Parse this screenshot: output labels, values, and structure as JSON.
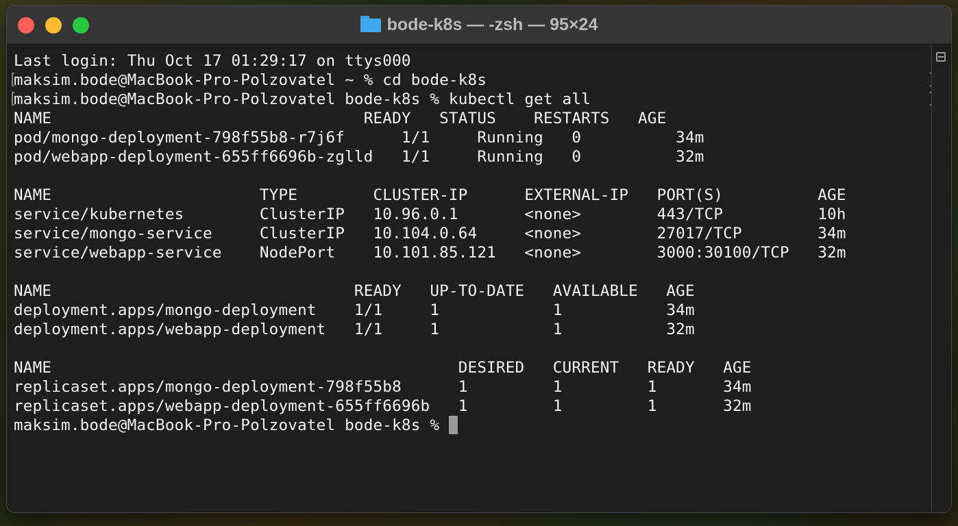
{
  "window": {
    "title": "bode-k8s — -zsh — 95×24",
    "folder_icon": "folder-icon"
  },
  "terminal": {
    "lines": [
      "Last login: Thu Oct 17 01:29:17 on ttys000",
      "maksim.bode@MacBook-Pro-Polzovatel ~ % cd bode-k8s",
      "maksim.bode@MacBook-Pro-Polzovatel bode-k8s % kubectl get all",
      "NAME                                 READY   STATUS    RESTARTS   AGE",
      "pod/mongo-deployment-798f55b8-r7j6f      1/1     Running   0          34m",
      "pod/webapp-deployment-655ff6696b-zglld   1/1     Running   0          32m",
      "",
      "NAME                      TYPE        CLUSTER-IP      EXTERNAL-IP   PORT(S)          AGE",
      "service/kubernetes        ClusterIP   10.96.0.1       <none>        443/TCP          10h",
      "service/mongo-service     ClusterIP   10.104.0.64     <none>        27017/TCP        34m",
      "service/webapp-service    NodePort    10.101.85.121   <none>        3000:30100/TCP   32m",
      "",
      "NAME                                READY   UP-TO-DATE   AVAILABLE   AGE",
      "deployment.apps/mongo-deployment    1/1     1            1           34m",
      "deployment.apps/webapp-deployment   1/1     1            1           32m",
      "",
      "NAME                                           DESIRED   CURRENT   READY   AGE",
      "replicaset.apps/mongo-deployment-798f55b8      1         1         1       34m",
      "replicaset.apps/webapp-deployment-655ff6696b   1         1         1       32m"
    ],
    "prompt": "maksim.bode@MacBook-Pro-Polzovatel bode-k8s % "
  }
}
